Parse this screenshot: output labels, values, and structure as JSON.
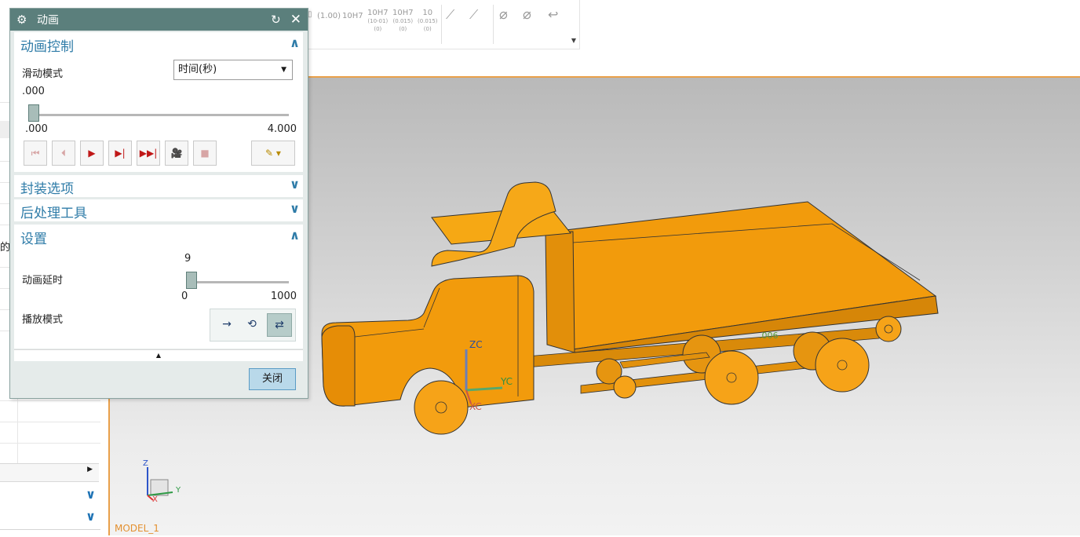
{
  "dialog": {
    "title": "动画",
    "animation_control": {
      "heading": "动画控制",
      "slide_mode_label": "滑动模式",
      "slide_mode_value": "时间(秒)",
      "current_value": ".000",
      "range_min": ".000",
      "range_max": "4.000",
      "slider_fraction": 0
    },
    "packaging_heading": "封装选项",
    "postprocess_heading": "后处理工具",
    "settings": {
      "heading": "设置",
      "delay_label": "动画延时",
      "delay_value": "9",
      "delay_min": "0",
      "delay_max": "1000",
      "play_mode_label": "播放模式"
    },
    "close_label": "关闭"
  },
  "toolbar": {
    "items": [
      "(1.00)",
      "10H7",
      "10H7",
      "10H7",
      "10"
    ],
    "subitems": [
      "",
      "",
      "(10-01)\n(0)",
      "(0.015)\n(0)",
      "(0.015)\n(0)"
    ]
  },
  "viewport": {
    "model_label": "MODEL_1",
    "csys_labels": {
      "zc": "ZC",
      "yc": "YC",
      "xc": "XC"
    },
    "triad_labels": {
      "z": "Z",
      "y": "Y",
      "x": "X"
    },
    "annotation": ".006"
  },
  "left_panel": {
    "partial_text": "的"
  },
  "colors": {
    "truck_orange": "#f29b0c",
    "dialog_title_bar": "#5b7f7c",
    "section_heading": "#2f7ca8",
    "viewport_border": "#e9a04a"
  }
}
